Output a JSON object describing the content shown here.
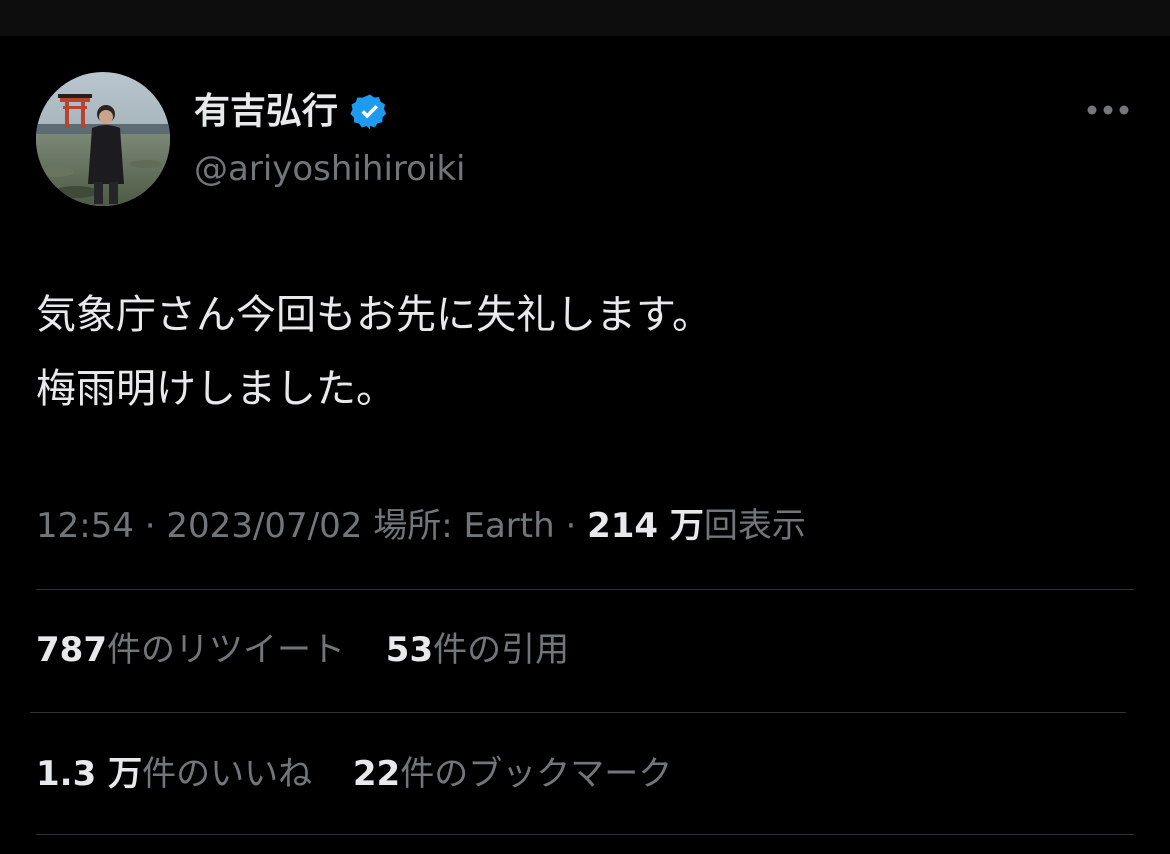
{
  "user": {
    "display_name": "有吉弘行",
    "handle": "@ariyoshihiroiki",
    "verified": true
  },
  "tweet": {
    "lines": [
      "気象庁さん今回もお先に失礼します。",
      "梅雨明けしました。"
    ]
  },
  "meta": {
    "time": "12:54",
    "sep1": "·",
    "date": "2023/07/02",
    "location_label": "場所: Earth",
    "sep2": "·",
    "views_count": "214 万",
    "views_label": "回表示"
  },
  "stats": {
    "retweets": {
      "count": "787",
      "label": "件のリツイート"
    },
    "quotes": {
      "count": "53",
      "label": "件の引用"
    },
    "likes": {
      "count": "1.3 万",
      "label": "件のいいね"
    },
    "bookmarks": {
      "count": "22",
      "label": "件のブックマーク"
    }
  },
  "icons": {
    "verified": "verified-badge-icon",
    "more": "more-horizontal-icon"
  },
  "colors": {
    "background": "#000000",
    "text_primary": "#e7e9ea",
    "text_secondary": "#71767b",
    "verified_blue": "#1d9bf0",
    "divider": "#2f3336"
  }
}
